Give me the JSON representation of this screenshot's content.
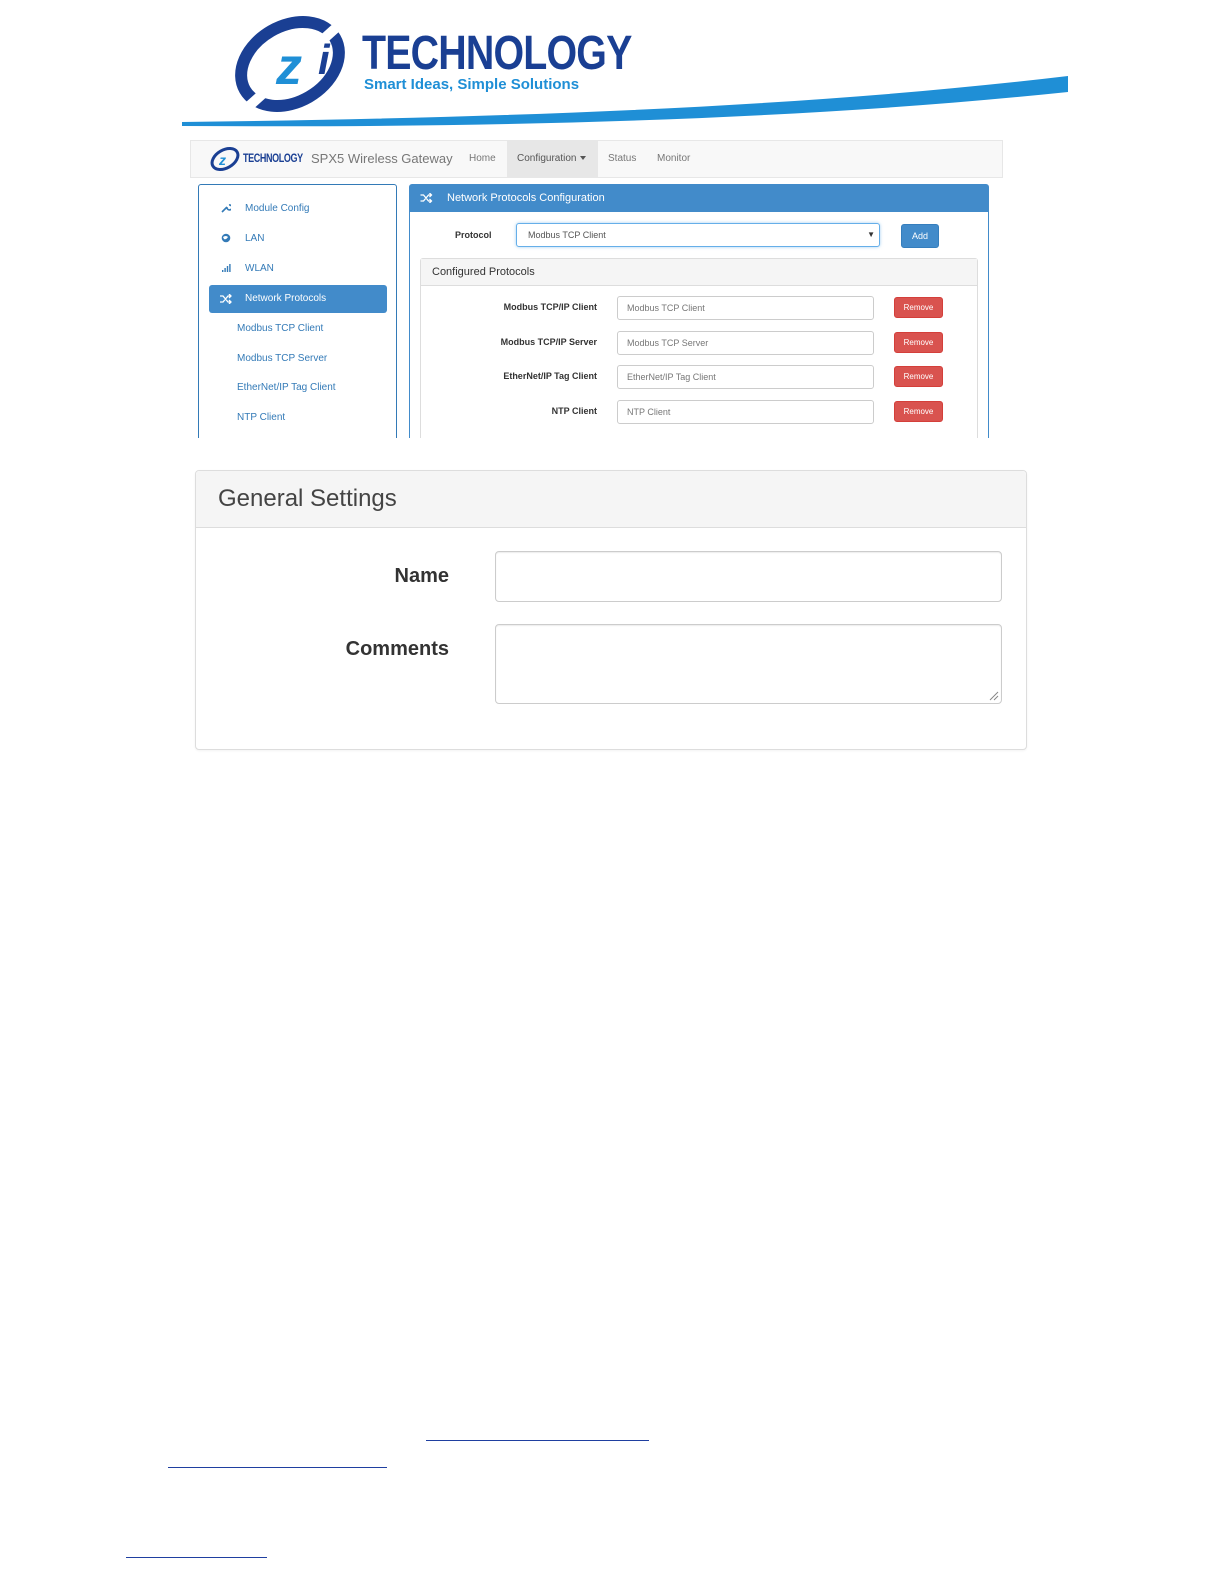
{
  "banner": {
    "brand_name": "TECHNOLOGY",
    "tagline": "Smart Ideas, Simple Solutions",
    "logo_letters": "iZi"
  },
  "app": {
    "navbar": {
      "logo_text": "TECHNOLOGY",
      "brand": "SPX5 Wireless Gateway",
      "items": [
        {
          "label": "Home"
        },
        {
          "label": "Configuration"
        },
        {
          "label": "Status"
        },
        {
          "label": "Monitor"
        }
      ]
    },
    "sidebar": {
      "items": [
        {
          "label": "Module Config",
          "icon": "wrench-icon"
        },
        {
          "label": "LAN",
          "icon": "globe-icon"
        },
        {
          "label": "WLAN",
          "icon": "signal-icon"
        },
        {
          "label": "Network Protocols",
          "icon": "shuffle-icon"
        }
      ],
      "subitems": [
        {
          "label": "Modbus TCP Client"
        },
        {
          "label": "Modbus TCP Server"
        },
        {
          "label": "EtherNet/IP Tag Client"
        },
        {
          "label": "NTP Client"
        }
      ]
    },
    "panel": {
      "title": "Network Protocols Configuration",
      "protocol_label": "Protocol",
      "protocol_value": "Modbus TCP Client",
      "add_label": "Add",
      "configured_title": "Configured Protocols",
      "rows": [
        {
          "label": "Modbus TCP/IP Client",
          "value": "Modbus TCP Client",
          "button": "Remove"
        },
        {
          "label": "Modbus TCP/IP Server",
          "value": "Modbus TCP Server",
          "button": "Remove"
        },
        {
          "label": "EtherNet/IP Tag Client",
          "value": "EtherNet/IP Tag Client",
          "button": "Remove"
        },
        {
          "label": "NTP Client",
          "value": "NTP Client",
          "button": "Remove"
        }
      ]
    }
  },
  "general_settings": {
    "title": "General Settings",
    "name_label": "Name",
    "name_value": "",
    "comments_label": "Comments",
    "comments_value": ""
  },
  "colors": {
    "brand_dark_blue": "#1a3f93",
    "brand_light_blue": "#1f8fd6",
    "primary": "#428bca",
    "danger": "#d9534f"
  }
}
